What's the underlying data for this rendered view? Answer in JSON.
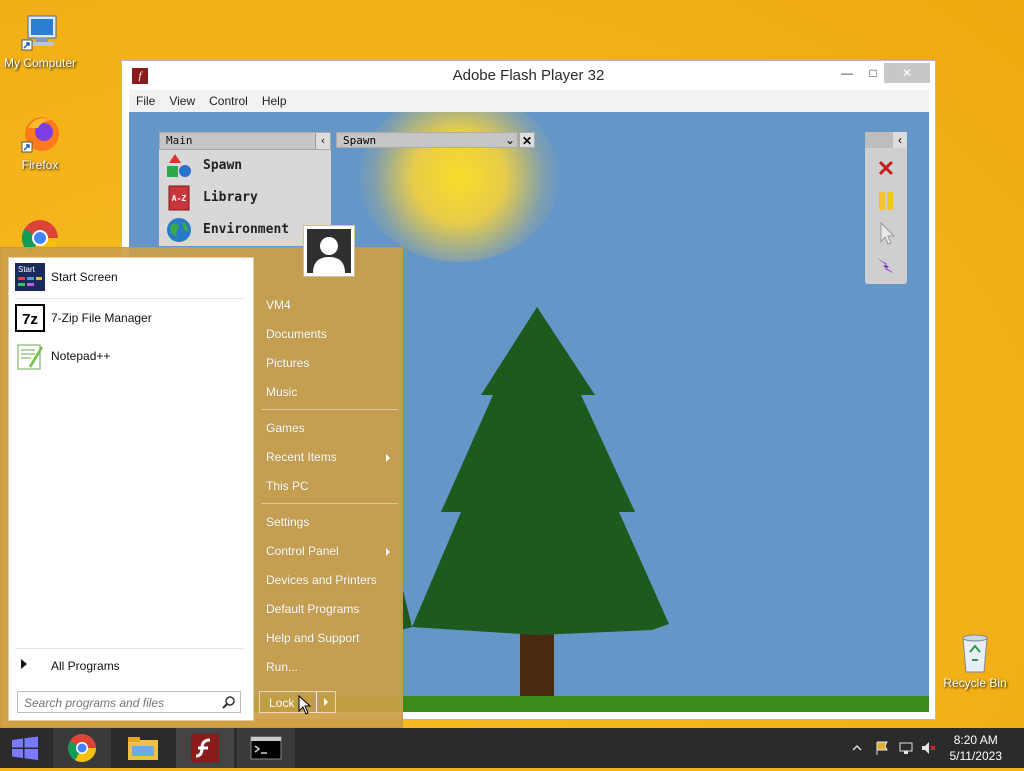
{
  "desktop": {
    "icons": [
      {
        "label": "My Computer"
      },
      {
        "label": "Firefox"
      },
      {
        "label": "Recycle Bin"
      }
    ]
  },
  "flash_window": {
    "title": "Adobe Flash Player 32",
    "menu": [
      "File",
      "View",
      "Control",
      "Help"
    ],
    "main_panel": {
      "header": "Main",
      "tools": [
        "Spawn",
        "Library",
        "Environment"
      ]
    },
    "spawn_panel": {
      "selected": "Spawn"
    }
  },
  "start_menu": {
    "programs": [
      "Start Screen",
      "7-Zip File Manager",
      "Notepad++"
    ],
    "program_icon_text": {
      "start": "Start",
      "zip": "7z"
    },
    "all_programs": "All Programs",
    "search_placeholder": "Search programs and files",
    "right_links": {
      "user": "VM4",
      "documents": "Documents",
      "pictures": "Pictures",
      "music": "Music",
      "games": "Games",
      "recent_items": "Recent Items",
      "this_pc": "This PC",
      "settings": "Settings",
      "control_panel": "Control Panel",
      "devices_printers": "Devices and Printers",
      "default_programs": "Default Programs",
      "help_support": "Help and Support",
      "run": "Run..."
    },
    "lock": "Lock"
  },
  "taskbar": {
    "time": "8:20 AM",
    "date": "5/11/2023"
  },
  "colors": {
    "desktop": "#f4b41a",
    "taskbar": "#2b2b2b",
    "sky": "#6496c8",
    "tree": "#1e5a1e",
    "ground": "#3a8c1a"
  }
}
